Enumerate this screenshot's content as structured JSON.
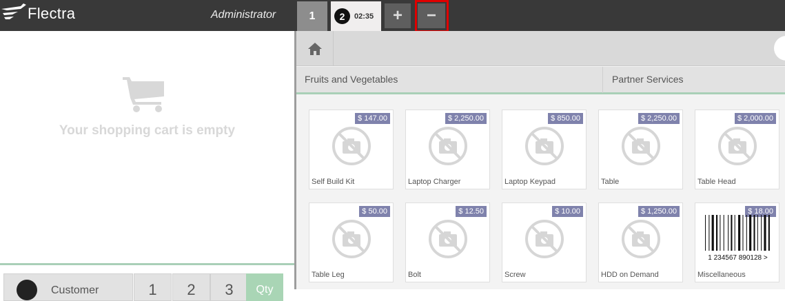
{
  "header": {
    "brand": "Flectra",
    "user": "Administrator",
    "order_tabs": [
      {
        "label": "1"
      },
      {
        "number": "2",
        "time": "02:35"
      }
    ],
    "add_label": "+",
    "remove_label": "−",
    "highlight_color": "#e00000"
  },
  "cart": {
    "empty_text": "Your shopping cart is empty"
  },
  "controls": {
    "customer_label": "Customer",
    "numpad": [
      "1",
      "2",
      "3"
    ],
    "qty_label": "Qty"
  },
  "categories": [
    "Fruits and Vegetables",
    "Partner Services"
  ],
  "products": [
    {
      "name": "Self Build Kit",
      "price": "$ 147.00"
    },
    {
      "name": "Laptop Charger",
      "price": "$ 2,250.00"
    },
    {
      "name": "Laptop Keypad",
      "price": "$ 850.00"
    },
    {
      "name": "Table",
      "price": "$ 2,250.00"
    },
    {
      "name": "Table Head",
      "price": "$ 2,000.00"
    },
    {
      "name": "Table Leg",
      "price": "$ 50.00"
    },
    {
      "name": "Bolt",
      "price": "$ 12.50"
    },
    {
      "name": "Screw",
      "price": "$ 10.00"
    },
    {
      "name": "HDD on Demand",
      "price": "$ 1,250.00"
    },
    {
      "name": "Miscellaneous",
      "price": "$ 18.00",
      "barcode_text": "1 234567 890128 >"
    }
  ],
  "colors": {
    "topbar": "#393939",
    "price_badge": "#7f82ac",
    "accent_green": "#a9cfb7"
  }
}
